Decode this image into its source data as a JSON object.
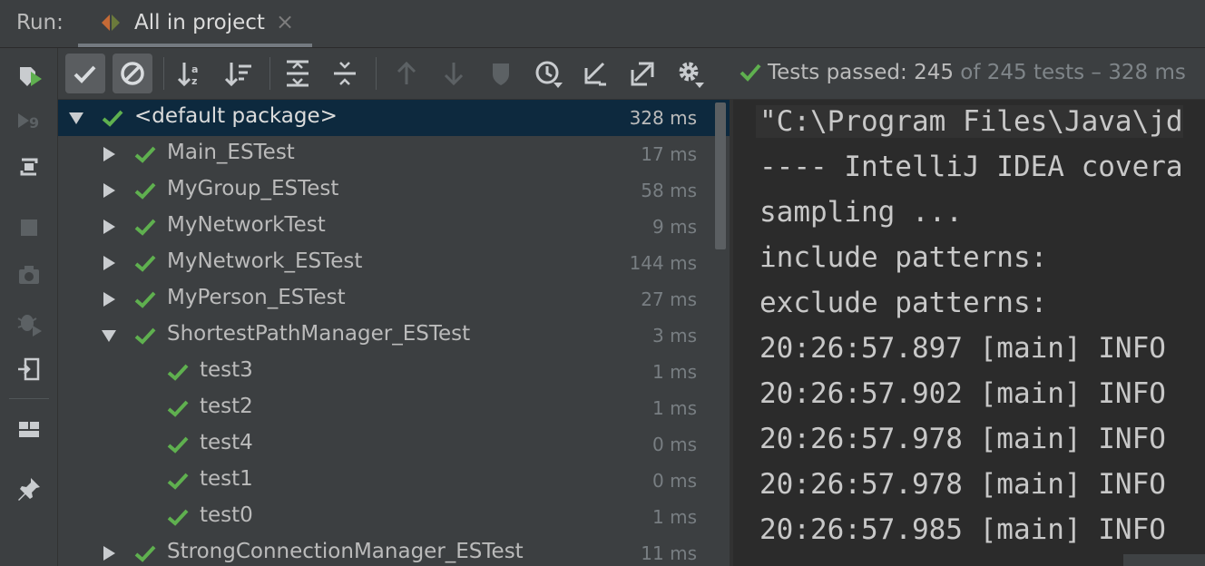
{
  "titlebar": {
    "run_label": "Run:",
    "tab_title": "All in project",
    "tab_close": "×"
  },
  "left_toolbar": {
    "icons": [
      "rerun-icon",
      "rerun-failed-icon",
      "toggle-auto-test-icon",
      "stop-icon",
      "snapshot-icon",
      "debug-icon",
      "restore-layout-icon",
      "layout-icon",
      "pin-tab-icon"
    ]
  },
  "top_toolbar": {
    "icons": [
      "show-passed-icon",
      "show-ignored-icon",
      "sort-alphabetically-icon",
      "sort-by-duration-icon",
      "expand-all-icon",
      "collapse-all-icon",
      "previous-failed-icon",
      "next-failed-icon",
      "coverage-icon",
      "test-history-icon",
      "import-tests-icon",
      "export-tests-icon",
      "settings-icon"
    ],
    "status": {
      "label": "Tests passed: ",
      "passed": "245",
      "total_text": " of 245 tests – 328 ms"
    }
  },
  "tree": {
    "rows": [
      {
        "name": "<default package>",
        "time": "328 ms",
        "level": 0,
        "arrow": "down",
        "selected": true
      },
      {
        "name": "Main_ESTest",
        "time": "17 ms",
        "level": 1,
        "arrow": "right"
      },
      {
        "name": "MyGroup_ESTest",
        "time": "58 ms",
        "level": 1,
        "arrow": "right"
      },
      {
        "name": "MyNetworkTest",
        "time": "9 ms",
        "level": 1,
        "arrow": "right"
      },
      {
        "name": "MyNetwork_ESTest",
        "time": "144 ms",
        "level": 1,
        "arrow": "right"
      },
      {
        "name": "MyPerson_ESTest",
        "time": "27 ms",
        "level": 1,
        "arrow": "right"
      },
      {
        "name": "ShortestPathManager_ESTest",
        "time": "3 ms",
        "level": 1,
        "arrow": "down"
      },
      {
        "name": "test3",
        "time": "1 ms",
        "level": 2,
        "arrow": "none"
      },
      {
        "name": "test2",
        "time": "1 ms",
        "level": 2,
        "arrow": "none"
      },
      {
        "name": "test4",
        "time": "0 ms",
        "level": 2,
        "arrow": "none"
      },
      {
        "name": "test1",
        "time": "0 ms",
        "level": 2,
        "arrow": "none"
      },
      {
        "name": "test0",
        "time": "1 ms",
        "level": 2,
        "arrow": "none"
      },
      {
        "name": "StrongConnectionManager_ESTest",
        "time": "11 ms",
        "level": 1,
        "arrow": "right"
      }
    ]
  },
  "console": {
    "lines": [
      "\"C:\\Program Files\\Java\\jd",
      "---- IntelliJ IDEA covera",
      "sampling ...",
      "include patterns:",
      "exclude patterns:",
      "20:26:57.897 [main] INFO",
      "20:26:57.902 [main] INFO",
      "20:26:57.978 [main] INFO",
      "20:26:57.978 [main] INFO",
      "20:26:57.985 [main] INFO"
    ]
  },
  "colors": {
    "background": "#3c3f41",
    "console_bg": "#2b2b2b",
    "selection": "#0d293e",
    "pass_green": "#5fb04f",
    "text": "#bbbbbb",
    "muted": "#787e82"
  }
}
